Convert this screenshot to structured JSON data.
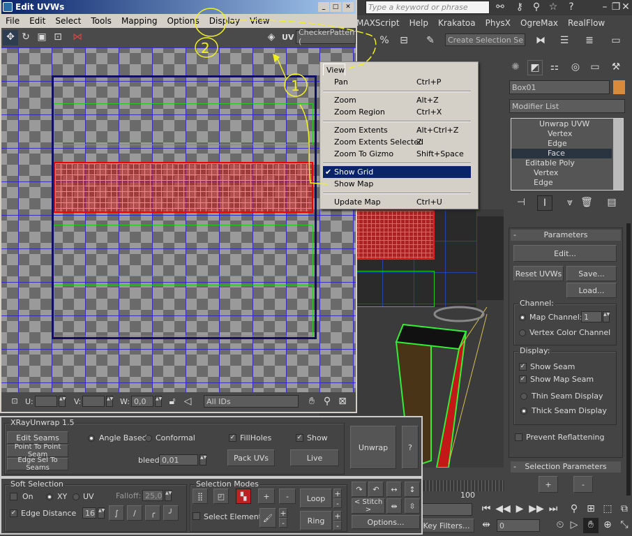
{
  "main_app": {
    "search_placeholder": "Type a keyword or phrase",
    "menu": [
      "MAXScript",
      "Help",
      "Krakatoa",
      "PhysX",
      "OgreMax",
      "RealFlow"
    ],
    "selection_set_placeholder": "Create Selection Se",
    "icons": [
      "binoculars-icon",
      "key-icon",
      "satellite-icon",
      "star-icon",
      "help-icon",
      "minimize-icon",
      "restore-icon",
      "close-icon"
    ]
  },
  "uvw_window": {
    "title": "Edit UVWs",
    "menu": [
      "File",
      "Edit",
      "Select",
      "Tools",
      "Mapping",
      "Options",
      "Display",
      "View"
    ],
    "uv_label": "UV",
    "texture_dropdown": "CheckerPattern  (",
    "bottom": {
      "u_label": "U:",
      "v_label": "V:",
      "w_label": "W:",
      "w_value": "0,0",
      "id_dropdown": "All IDs"
    }
  },
  "view_menu": {
    "title": "View",
    "items": [
      {
        "label": "Pan",
        "shortcut": "Ctrl+P"
      },
      {
        "label": "Zoom",
        "shortcut": "Alt+Z"
      },
      {
        "label": "Zoom Region",
        "shortcut": "Ctrl+X"
      },
      {
        "label": "Zoom Extents",
        "shortcut": "Alt+Ctrl+Z"
      },
      {
        "label": "Zoom Extents Selected",
        "shortcut": "Z"
      },
      {
        "label": "Zoom To Gizmo",
        "shortcut": "Shift+Space"
      },
      {
        "label": "Show Grid",
        "shortcut": "",
        "checked": true,
        "highlighted": true
      },
      {
        "label": "Show Map",
        "shortcut": ""
      },
      {
        "label": "Update Map",
        "shortcut": "Ctrl+U"
      }
    ]
  },
  "annotations": {
    "one": "1",
    "two": "2",
    "color": "#f0f020"
  },
  "command_panel": {
    "object_name": "Box01",
    "object_color": "#d98a3a",
    "modifier_list": "Modifier List",
    "stack": [
      {
        "label": "Unwrap UVW",
        "level": 0
      },
      {
        "label": "Vertex",
        "level": 1
      },
      {
        "label": "Edge",
        "level": 1
      },
      {
        "label": "Face",
        "level": 1,
        "selected": true
      },
      {
        "label": "Editable Poly",
        "level": 0
      },
      {
        "label": "Vertex",
        "level": 1
      },
      {
        "label": "Edge",
        "level": 1
      }
    ],
    "parameters": {
      "title": "Parameters",
      "edit": "Edit...",
      "reset": "Reset UVWs",
      "save": "Save...",
      "load": "Load...",
      "channel_group": "Channel:",
      "map_channel": "Map Channel:",
      "map_channel_value": "1",
      "vertex_color": "Vertex Color Channel",
      "display_group": "Display:",
      "show_seam": "Show Seam",
      "show_map_seam": "Show Map Seam",
      "thin_seam": "Thin Seam Display",
      "thick_seam": "Thick Seam Display",
      "prevent": "Prevent Reflattening"
    },
    "selection_parameters": {
      "title": "Selection Parameters",
      "plus": "+",
      "minus": "-"
    }
  },
  "xray": {
    "title": "XRayUnwrap 1.5",
    "edit_seams": "Edit Seams",
    "p2p": "Point To Point Seam",
    "edge_sel": "Edge Sel To Seams",
    "angle_based": "Angle Based",
    "conformal": "Conformal",
    "fillholes": "FillHoles",
    "show": "Show",
    "bleed_label": "bleed",
    "bleed_value": "0,01",
    "pack": "Pack UVs",
    "live": "Live",
    "unwrap": "Unwrap",
    "help": "?"
  },
  "soft_selection": {
    "title": "Soft Selection",
    "on": "On",
    "xy": "XY",
    "uv": "UV",
    "falloff_label": "Falloff:",
    "falloff_value": "25,0",
    "edge_distance": "Edge Distance",
    "edge_value": "16"
  },
  "selection_modes": {
    "title": "Selection Modes",
    "plus": "+",
    "minus": "-",
    "loop": "Loop",
    "ring": "Ring",
    "select_element": "Select Element",
    "stitch": "< Stitch >",
    "options": "Options..."
  },
  "timeline": {
    "frame_end": "100",
    "key_filters": "Key Filters...",
    "frame_value": "0"
  }
}
